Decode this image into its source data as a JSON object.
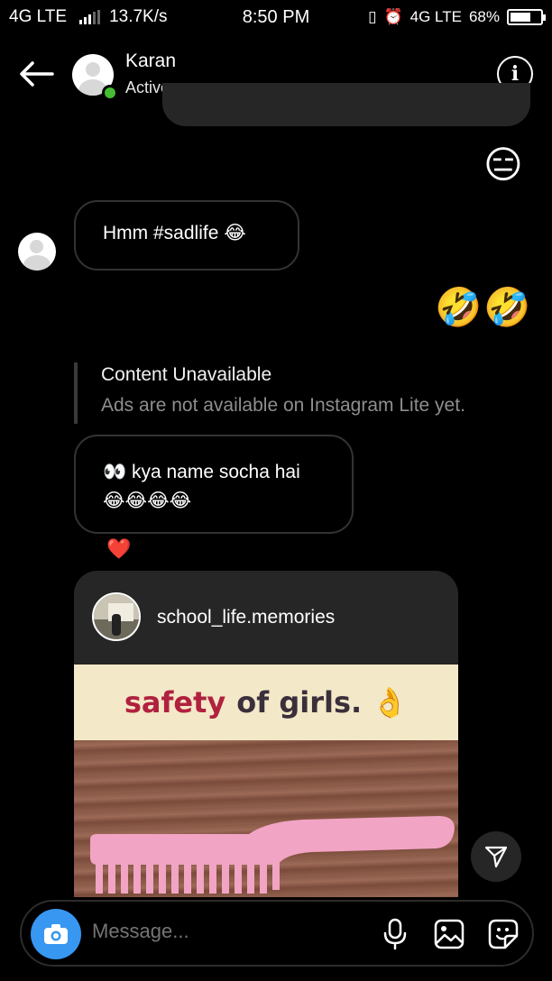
{
  "status_bar": {
    "network_left": "4G LTE",
    "speed": "13.7K/s",
    "time": "8:50 PM",
    "network_right": "4G LTE",
    "battery": "68%",
    "battery_level": 0.68
  },
  "header": {
    "contact_name": "Karan",
    "contact_status": "Active now",
    "online_color": "#44bd32"
  },
  "messages": [
    {
      "type": "emoji",
      "sender": "me",
      "text": "😑"
    },
    {
      "type": "text",
      "sender": "them",
      "text": "Hmm #sadlife 😂"
    },
    {
      "type": "emoji",
      "sender": "me",
      "text": "🤣🤣"
    },
    {
      "type": "unavailable",
      "title": "Content Unavailable",
      "description": "Ads are not available on Instagram Lite yet."
    },
    {
      "type": "text",
      "sender": "them",
      "line1": "👀 kya name socha hai",
      "line2": "😂😂😂😂"
    },
    {
      "type": "reaction",
      "text": "❤️"
    },
    {
      "type": "post_share",
      "username": "school_life.memories",
      "caption_part1": "safety",
      "caption_part2": "of girls. 👌"
    }
  ],
  "composer": {
    "placeholder": "Message...",
    "accent_color": "#3897f0"
  },
  "icons": [
    "back-arrow-icon",
    "info-icon",
    "send-icon",
    "camera-icon",
    "microphone-icon",
    "gallery-icon",
    "sticker-icon"
  ]
}
